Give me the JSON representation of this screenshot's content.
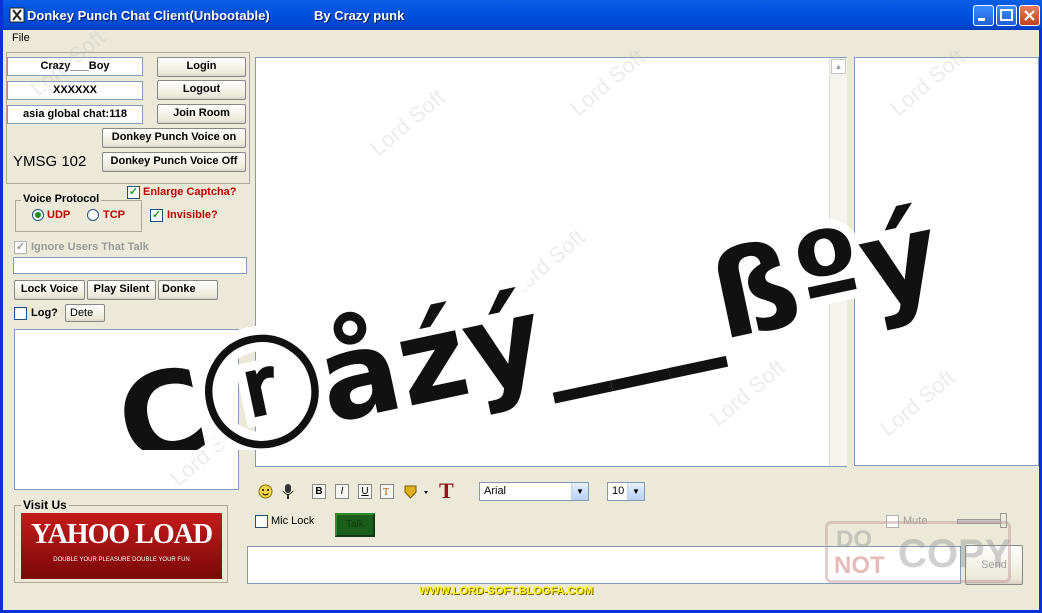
{
  "window": {
    "title": "Donkey Punch Chat Client(Unbootable)",
    "credit": "By Crazy punk"
  },
  "menu": {
    "file": "File"
  },
  "login": {
    "username": "Crazy___Boy",
    "password": "XXXXXX",
    "room": "asia global chat:118",
    "login_label": "Login",
    "logout_label": "Logout",
    "join_room_label": "Join Room",
    "voice_on_label": "Donkey Punch Voice on",
    "voice_off_label": "Donkey Punch Voice Off",
    "protocol_version": "YMSG  102"
  },
  "options": {
    "enlarge_captcha": "Enlarge Captcha?",
    "invisible": "Invisible?",
    "voice_protocol_title": "Voice Protocol",
    "udp": "UDP",
    "tcp": "TCP",
    "ignore_users": "Ignore Users That Talk"
  },
  "voice_buttons": {
    "lock_voice": "Lock Voice",
    "play_silent": "Play Silent",
    "donkey": "Donke"
  },
  "log": {
    "label": "Log?",
    "detect": "Dete"
  },
  "visit": {
    "title": "Visit Us",
    "banner_main": "YAHOO LOAD",
    "banner_sub": "DOUBLE YOUR PLEASURE  DOUBLE YOUR FUN"
  },
  "overlay": {
    "text": "Çⓡåźý___ßºý"
  },
  "toolbar": {
    "bold": "B",
    "italic": "I",
    "underline": "U",
    "font": "Arial",
    "size": "10"
  },
  "bottom": {
    "mic_lock": "Mic Lock",
    "talk": "Talk",
    "mute": "Mute",
    "send": "Send",
    "footer_url": "WWW.LORD-SOFT.BLOGFA.COM",
    "stamp_top": "DO",
    "stamp_bottom": "NOT",
    "stamp_copy": "COPY"
  },
  "watermark": "Lord Soft",
  "colors": {
    "titlebar": "#0053e1",
    "panel_bg": "#ece9d8",
    "checkbox_label": "#c00000",
    "talk_button": "#1b5e1b",
    "footer_url": "#ffff00"
  }
}
